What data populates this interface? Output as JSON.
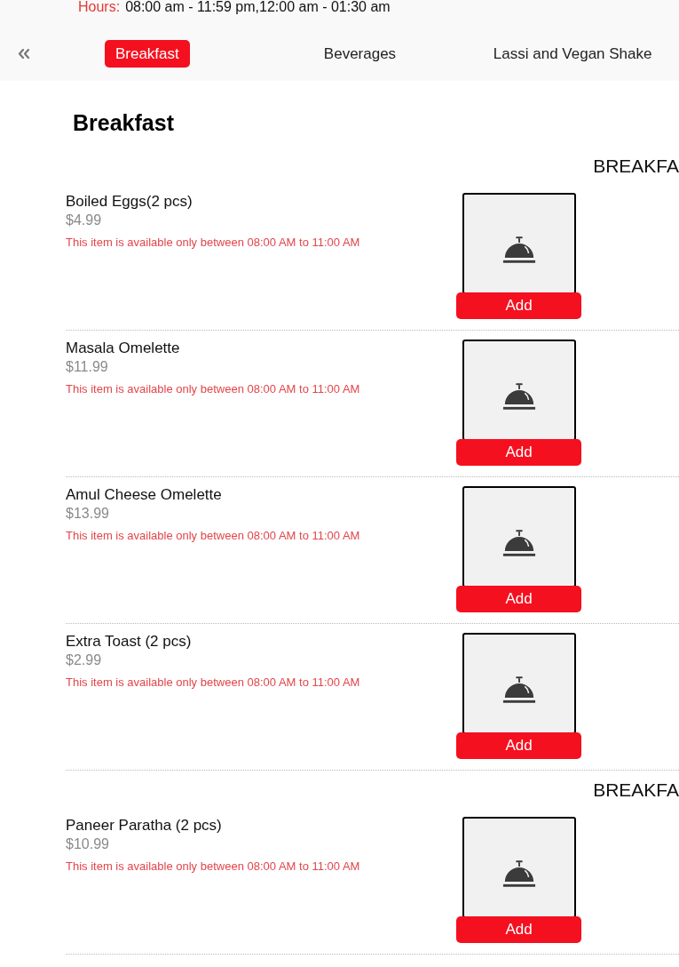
{
  "header": {
    "hours_label": "Hours:",
    "hours": "08:00 am - 11:59 pm,12:00 am - 01:30 am"
  },
  "tabs": [
    {
      "label": "Breakfast",
      "selected": true
    },
    {
      "label": "Beverages",
      "selected": false
    },
    {
      "label": "Lassi and Vegan Shake",
      "selected": false
    }
  ],
  "section": {
    "title": "Breakfast",
    "groups": [
      {
        "label": "BREAKFA",
        "items": [
          {
            "name": "Boiled Eggs(2 pcs)",
            "price": "$4.99",
            "note": "This item is available only between 08:00 AM to 11:00 AM",
            "button": "Add"
          },
          {
            "name": "Masala Omelette",
            "price": "$11.99",
            "note": "This item is available only between 08:00 AM to 11:00 AM",
            "button": "Add"
          },
          {
            "name": "Amul Cheese Omelette",
            "price": "$13.99",
            "note": "This item is available only between 08:00 AM to 11:00 AM",
            "button": "Add"
          },
          {
            "name": "Extra Toast (2 pcs)",
            "price": "$2.99",
            "note": "This item is available only between 08:00 AM to 11:00 AM",
            "button": "Add"
          }
        ]
      },
      {
        "label": "BREAKFA",
        "items": [
          {
            "name": "Paneer Paratha (2 pcs)",
            "price": "$10.99",
            "note": "This item is available only between 08:00 AM to 11:00 AM",
            "button": "Add"
          }
        ]
      }
    ]
  }
}
